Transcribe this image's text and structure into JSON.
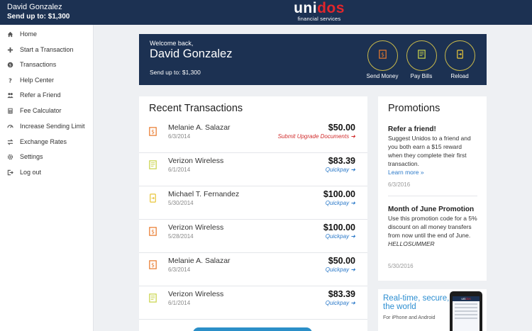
{
  "topbar": {
    "user_name": "David Gonzalez",
    "send_up_to": "Send up to: $1,300",
    "logo_part1": "uni",
    "logo_part2": "dos",
    "logo_subtitle": "financial services",
    "brand_red": "#e2262c",
    "brand_navy": "#1c3152"
  },
  "sidebar": {
    "items": [
      {
        "label": "Home",
        "icon": "home-icon"
      },
      {
        "label": "Start a Transaction",
        "icon": "plus-icon"
      },
      {
        "label": "Transactions",
        "icon": "dollar-icon"
      },
      {
        "label": "Help Center",
        "icon": "question-icon"
      },
      {
        "label": "Refer a Friend",
        "icon": "people-icon"
      },
      {
        "label": "Fee Calculator",
        "icon": "calculator-icon"
      },
      {
        "label": "Increase Sending Limit",
        "icon": "gauge-icon"
      },
      {
        "label": "Exchange Rates",
        "icon": "exchange-icon"
      },
      {
        "label": "Settings",
        "icon": "gear-icon"
      },
      {
        "label": "Log out",
        "icon": "logout-icon"
      }
    ]
  },
  "welcome": {
    "label": "Welcome back,",
    "name": "David Gonzalez",
    "send_up_to": "Send up to: $1,300",
    "actions": [
      {
        "label": "Send Money",
        "icon": "send-money-icon",
        "color": "#e97a2c"
      },
      {
        "label": "Pay Bills",
        "icon": "pay-bills-icon",
        "color": "#c9d44a"
      },
      {
        "label": "Reload",
        "icon": "reload-icon",
        "color": "#e8c53a"
      }
    ]
  },
  "transactions": {
    "title": "Recent Transactions",
    "rows": [
      {
        "name": "Melanie A. Salazar",
        "date": "6/3/2014",
        "amount": "$50.00",
        "action": "Submit Upgrade Documents ➜",
        "action_type": "red",
        "icon": "send-money-icon"
      },
      {
        "name": "Verizon Wireless",
        "date": "6/1/2014",
        "amount": "$83.39",
        "action": "Quickpay ➜",
        "action_type": "blue",
        "icon": "pay-bills-icon"
      },
      {
        "name": "Michael T. Fernandez",
        "date": "5/30/2014",
        "amount": "$100.00",
        "action": "Quickpay ➜",
        "action_type": "blue",
        "icon": "reload-icon"
      },
      {
        "name": "Verizon Wireless",
        "date": "5/28/2014",
        "amount": "$100.00",
        "action": "Quickpay ➜",
        "action_type": "blue",
        "icon": "send-money-icon"
      },
      {
        "name": "Melanie A. Salazar",
        "date": "6/3/2014",
        "amount": "$50.00",
        "action": "Quickpay ➜",
        "action_type": "blue",
        "icon": "send-money-icon"
      },
      {
        "name": "Verizon Wireless",
        "date": "6/1/2014",
        "amount": "$83.39",
        "action": "Quickpay ➜",
        "action_type": "blue",
        "icon": "pay-bills-icon"
      }
    ]
  },
  "promotions": {
    "title": "Promotions",
    "items": [
      {
        "heading": "Refer a friend!",
        "body": "Suggest Unidos to a friend and you both earn a $15 reward when they complete their first transaction.",
        "link": "Learn more »",
        "date": "6/3/2016"
      },
      {
        "heading": "Month of June Promotion",
        "body": "Use this promotion code for a 5% discount on all money transfers from now until the end of June.",
        "code": "HELLOSUMMER",
        "date": "5/30/2016"
      }
    ]
  },
  "ad": {
    "title": "Real-time, secure, around the world",
    "subtitle": "For iPhone and Android",
    "phone_logo_part1": "uni",
    "phone_logo_part2": "dos"
  }
}
